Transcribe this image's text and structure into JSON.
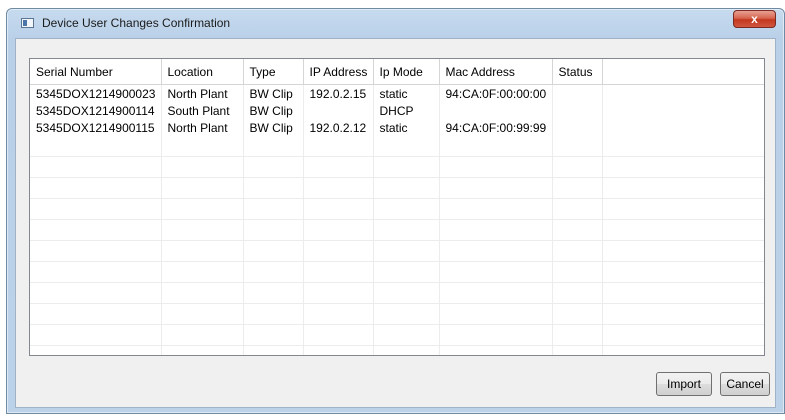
{
  "window": {
    "title": "Device User Changes Confirmation",
    "close_label": "x"
  },
  "table": {
    "columns": [
      "Serial Number",
      "Location",
      "Type",
      "IP Address",
      "Ip Mode",
      "Mac Address",
      "Status",
      ""
    ],
    "rows": [
      [
        "5345DOX1214900023",
        "North Plant",
        "BW Clip",
        "192.0.2.15",
        "static",
        "94:CA:0F:00:00:00",
        "",
        ""
      ],
      [
        "5345DOX1214900114",
        "South Plant",
        "BW Clip",
        "",
        "DHCP",
        "",
        "",
        ""
      ],
      [
        "5345DOX1214900115",
        "North Plant",
        "BW Clip",
        "192.0.2.12",
        "static",
        "94:CA:0F:00:99:99",
        "",
        ""
      ]
    ]
  },
  "buttons": {
    "import_label": "Import",
    "cancel_label": "Cancel"
  }
}
